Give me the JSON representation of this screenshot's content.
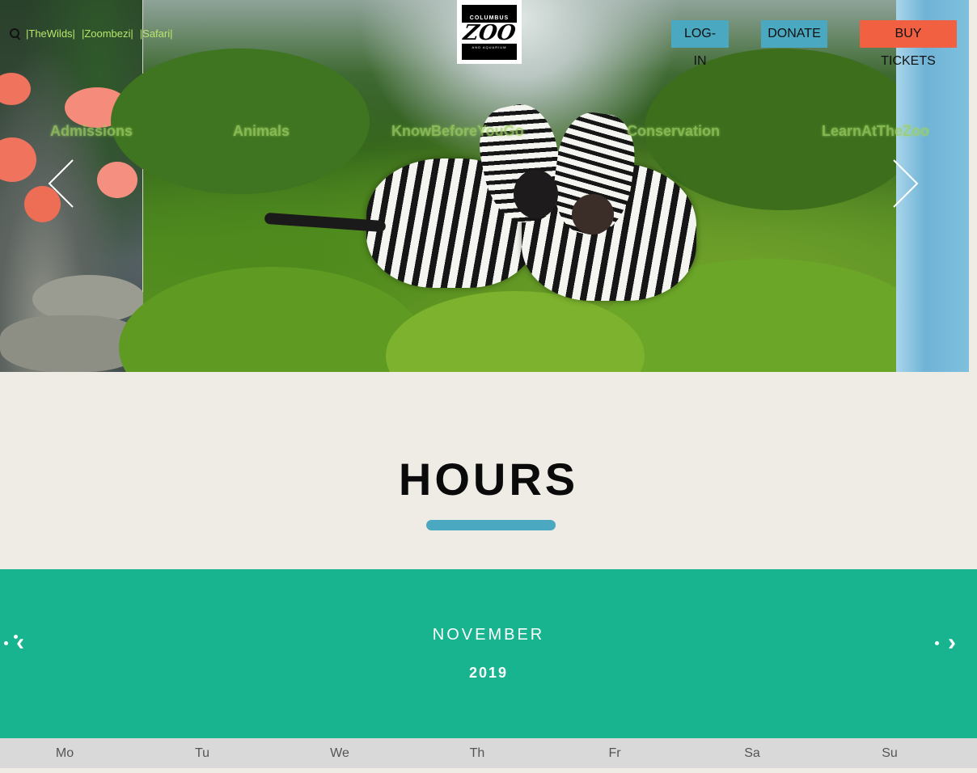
{
  "header": {
    "utility_links": [
      "|TheWilds|",
      "|Zoombezi|",
      "|Safari|"
    ],
    "logo": {
      "top": "COLUMBUS",
      "main": "ZOO",
      "bottom": "AND AQUARIUM"
    },
    "buttons": {
      "login": "LOG-IN",
      "donate": "DONATE",
      "tickets": "BUY TICKETS"
    }
  },
  "nav": {
    "items": [
      "Admissions",
      "Animals",
      "KnowBeforeYouGo",
      "Conservation",
      "LearnAtTheZoo"
    ]
  },
  "hours": {
    "title": "HOURS"
  },
  "calendar": {
    "month": "NOVEMBER",
    "year": "2019",
    "prev_label": "‹",
    "next_label": "›",
    "weekdays": [
      "Mo",
      "Tu",
      "We",
      "Th",
      "Fr",
      "Sa",
      "Su"
    ]
  },
  "colors": {
    "accent_blue": "#4aa8c0",
    "ticket_orange": "#f16141",
    "calendar_green": "#18b38f"
  }
}
